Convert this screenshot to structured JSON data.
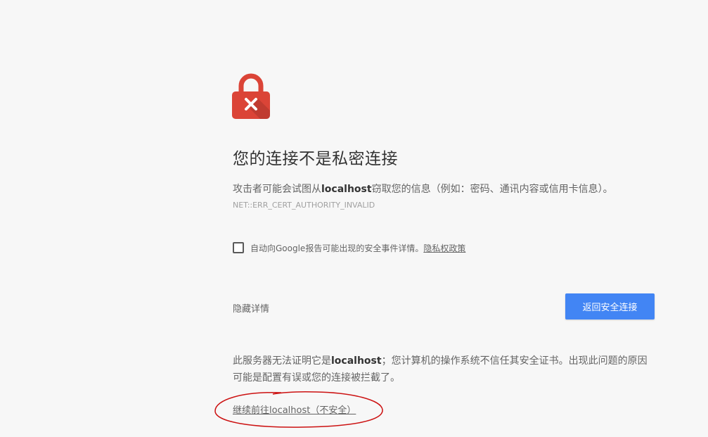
{
  "interstitial": {
    "icon": "lock-error-icon",
    "title": "您的连接不是私密连接",
    "description": {
      "prefix": "攻击者可能会试图从",
      "host": "localhost",
      "suffix": "窃取您的信息（例如：密码、通讯内容或信用卡信息）。"
    },
    "error_code": "NET::ERR_CERT_AUTHORITY_INVALID",
    "report": {
      "checked": false,
      "label": "自动向Google报告可能出现的安全事件详情。",
      "privacy_link": "隐私权政策"
    },
    "details_button": "隐藏详情",
    "back_button": "返回安全连接",
    "explanation": {
      "prefix": "此服务器无法证明它是",
      "host": "localhost",
      "suffix": "；您计算机的操作系统不信任其安全证书。出现此问题的原因可能是配置有误或您的连接被拦截了。"
    },
    "proceed_link": "继续前往localhost（不安全）"
  },
  "colors": {
    "background": "#f7f7f7",
    "lock_red": "#db4437",
    "primary_button": "#4285f4",
    "annotation_red": "#cc1111"
  }
}
